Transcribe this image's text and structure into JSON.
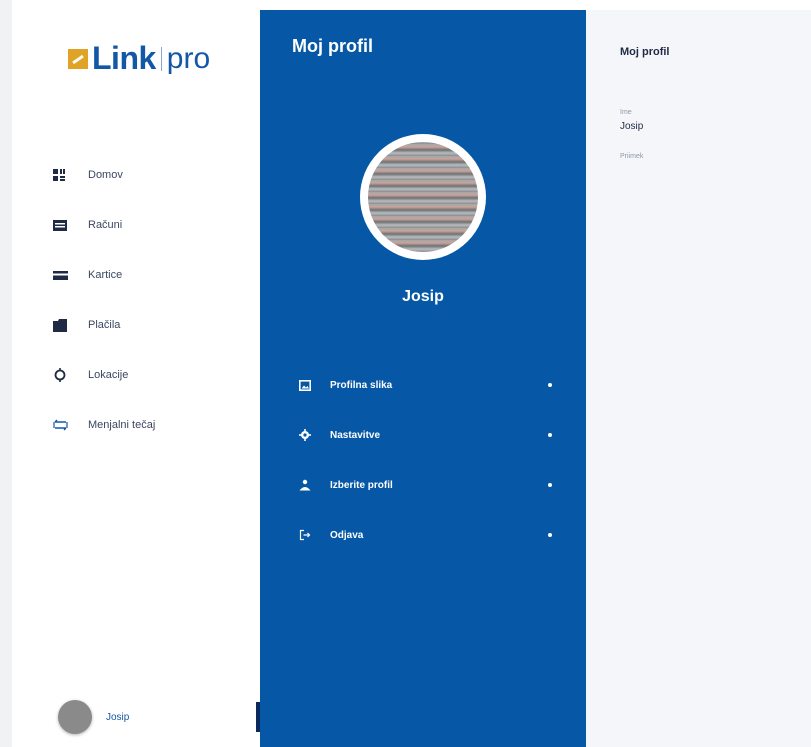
{
  "logo": {
    "brand": "Link",
    "suffix": "pro"
  },
  "sidebar": {
    "items": [
      {
        "label": "Domov",
        "icon": "home-icon"
      },
      {
        "label": "Računi",
        "icon": "accounts-icon"
      },
      {
        "label": "Kartice",
        "icon": "card-icon"
      },
      {
        "label": "Plačila",
        "icon": "wallet-icon"
      },
      {
        "label": "Lokacije",
        "icon": "location-icon"
      },
      {
        "label": "Menjalni tečaj",
        "icon": "exchange-icon"
      }
    ],
    "user": {
      "name": "Josip"
    }
  },
  "profile_panel": {
    "title": "Moj profil",
    "name": "Josip",
    "menu": [
      {
        "label": "Profilna slika",
        "icon": "image-icon"
      },
      {
        "label": "Nastavitve",
        "icon": "gear-icon"
      },
      {
        "label": "Izberite profil",
        "icon": "user-icon"
      },
      {
        "label": "Odjava",
        "icon": "logout-icon"
      }
    ]
  },
  "detail": {
    "title": "Moj profil",
    "fields": [
      {
        "label": "Ime",
        "value": "Josip"
      },
      {
        "label": "Priimek",
        "value": ""
      }
    ]
  },
  "colors": {
    "primary": "#0658a6",
    "brand_blue": "#1358a6",
    "brand_gold": "#e0a325",
    "detail_bg": "#f4f6fa"
  }
}
